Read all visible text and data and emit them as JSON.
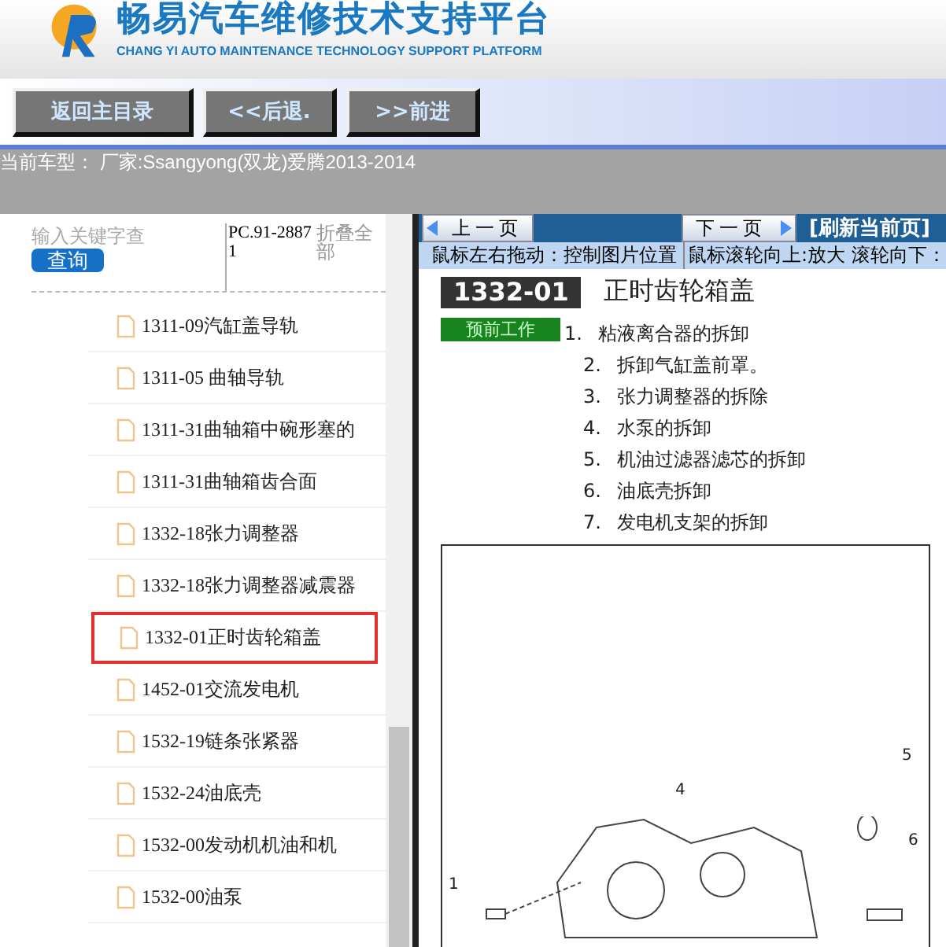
{
  "header": {
    "title": "畅易汽车维修技术支持平台",
    "subtitle": "CHANG YI AUTO MAINTENANCE TECHNOLOGY SUPPORT PLATFORM"
  },
  "toolbar": {
    "buttons": [
      "返回主目录",
      "<<后退.",
      ">>前进"
    ]
  },
  "current_model": "当前车型： 厂家:Ssangyong(双龙)爱腾2013-2014",
  "sidebar": {
    "search": {
      "placeholder": "输入关键字查"
    },
    "search_button": "查询",
    "code": "PC.91-28871",
    "collapse_link": "折叠全部",
    "items": [
      {
        "label": "1311-09汽缸盖导轨",
        "selected": false
      },
      {
        "label": "1311-05 曲轴导轨",
        "selected": false
      },
      {
        "label": "1311-31曲轴箱中碗形塞的",
        "selected": false
      },
      {
        "label": "1311-31曲轴箱齿合面",
        "selected": false
      },
      {
        "label": "1332-18张力调整器",
        "selected": false
      },
      {
        "label": "1332-18张力调整器减震器",
        "selected": false
      },
      {
        "label": "1332-01正时齿轮箱盖",
        "selected": true
      },
      {
        "label": "1452-01交流发电机",
        "selected": false
      },
      {
        "label": "1532-19链条张紧器",
        "selected": false
      },
      {
        "label": "1532-24油底壳",
        "selected": false
      },
      {
        "label": "1532-00发动机机油和机",
        "selected": false
      },
      {
        "label": "1532-00油泵",
        "selected": false
      }
    ]
  },
  "viewer": {
    "prev_button": "上一页",
    "next_button": "下一页",
    "refresh_link": "[刷新当前页]",
    "hints": [
      "鼠标左右拖动：控制图片位置",
      "鼠标滚轮向上:放大",
      "滚轮向下："
    ],
    "document": {
      "code": "1332-01",
      "title": "正时齿轮箱盖",
      "tag": "预前工作",
      "steps": [
        {
          "number": "1.",
          "text": "粘液离合器的拆卸"
        },
        {
          "number": "2.",
          "text": "拆卸气缸盖前罩。"
        },
        {
          "number": "3.",
          "text": "张力调整器的拆除"
        },
        {
          "number": "4.",
          "text": "水泵的拆卸"
        },
        {
          "number": "5.",
          "text": "机油过滤器滤芯的拆卸"
        },
        {
          "number": "6.",
          "text": "油底壳拆卸"
        },
        {
          "number": "7.",
          "text": "发电机支架的拆卸"
        }
      ],
      "callouts": [
        "1",
        "4",
        "5",
        "6"
      ]
    }
  }
}
